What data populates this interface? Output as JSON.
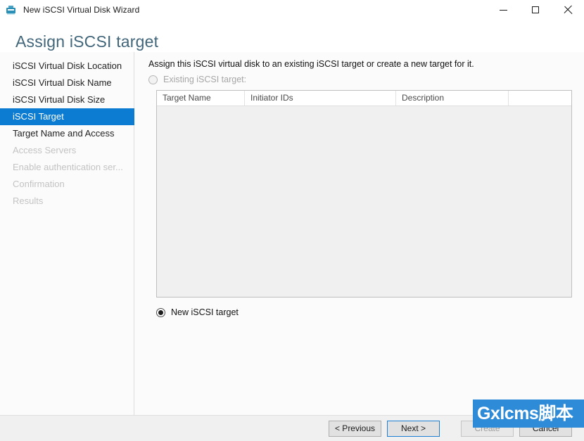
{
  "window": {
    "title": "New iSCSI Virtual Disk Wizard",
    "icon": "iscsi-disk-icon",
    "controls": {
      "minimize": "minimize-icon",
      "maximize": "maximize-icon",
      "close": "close-icon"
    }
  },
  "page": {
    "heading": "Assign iSCSI target",
    "heading_color": "#42667a"
  },
  "sidebar": {
    "items": [
      {
        "label": "iSCSI Virtual Disk Location",
        "state": "enabled"
      },
      {
        "label": "iSCSI Virtual Disk Name",
        "state": "enabled"
      },
      {
        "label": "iSCSI Virtual Disk Size",
        "state": "enabled"
      },
      {
        "label": "iSCSI Target",
        "state": "selected"
      },
      {
        "label": "Target Name and Access",
        "state": "enabled"
      },
      {
        "label": "Access Servers",
        "state": "disabled"
      },
      {
        "label": "Enable authentication ser...",
        "state": "disabled"
      },
      {
        "label": "Confirmation",
        "state": "disabled"
      },
      {
        "label": "Results",
        "state": "disabled"
      }
    ],
    "selected_color": "#0c7cd2"
  },
  "main": {
    "instruction": "Assign this iSCSI virtual disk to an existing iSCSI target or create a new target for it.",
    "existing_radio": {
      "label": "Existing iSCSI target:",
      "checked": false,
      "enabled": false
    },
    "new_radio": {
      "label": "New iSCSI target",
      "checked": true,
      "enabled": true
    },
    "table": {
      "columns": [
        "Target Name",
        "Initiator IDs",
        "Description",
        ""
      ],
      "rows": []
    }
  },
  "footer": {
    "buttons": [
      {
        "label": "< Previous",
        "state": "enabled"
      },
      {
        "label": "Next >",
        "state": "default"
      },
      {
        "label": "Create",
        "state": "disabled"
      },
      {
        "label": "Cancel",
        "state": "enabled"
      }
    ]
  },
  "watermark": {
    "text": "Gxlcms脚本",
    "background": "#2e8bd8",
    "color": "#ffffff"
  }
}
